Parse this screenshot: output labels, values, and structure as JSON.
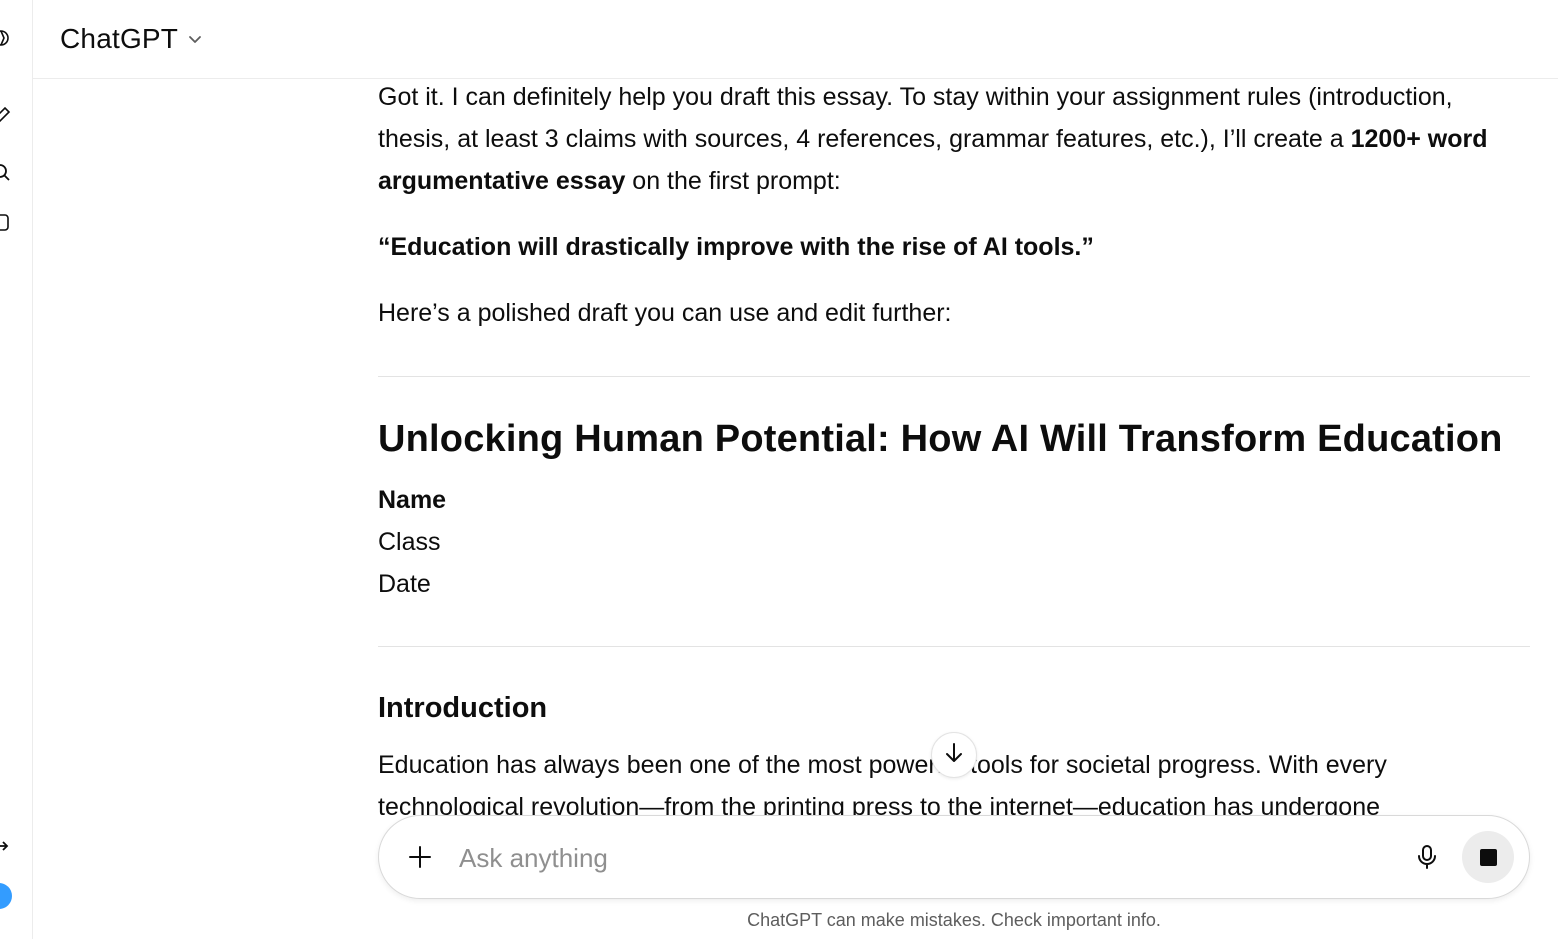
{
  "header": {
    "model_name": "ChatGPT",
    "chevron_icon": "chevron-down-icon"
  },
  "sidebar_rail": {
    "icons": [
      "logo-icon",
      "new-chat-icon",
      "search-icon",
      "library-icon",
      "collapse-icon"
    ],
    "avatar_color": "#339cff"
  },
  "message": {
    "intro_part1": "Got it. I can definitely help you draft this essay. To stay within your assignment rules (introduction, thesis, at least 3 claims with sources, 4 references, grammar features, etc.), I’ll create a ",
    "intro_bold": "1200+ word argumentative essay",
    "intro_part2": " on the first prompt:",
    "prompt_quote": "“Education will drastically improve with the rise of AI tools.”",
    "lead_in": "Here’s a polished draft you can use and edit further:",
    "essay_title": "Unlocking Human Potential: How AI Will Transform Education",
    "meta_name": "Name",
    "meta_class": "Class",
    "meta_date": "Date",
    "section_heading": "Introduction",
    "section_line1": "Education has always been one of the most powerful tools for societal progress. With every",
    "section_line2": "technological revolution—from the printing press to the internet—education has undergone"
  },
  "composer": {
    "placeholder": "Ask anything",
    "value": "",
    "add_icon": "plus-icon",
    "mic_icon": "microphone-icon",
    "stop_icon": "stop-icon"
  },
  "scroll_down_icon": "arrow-down-icon",
  "footer": {
    "disclaimer": "ChatGPT can make mistakes. Check important info."
  }
}
